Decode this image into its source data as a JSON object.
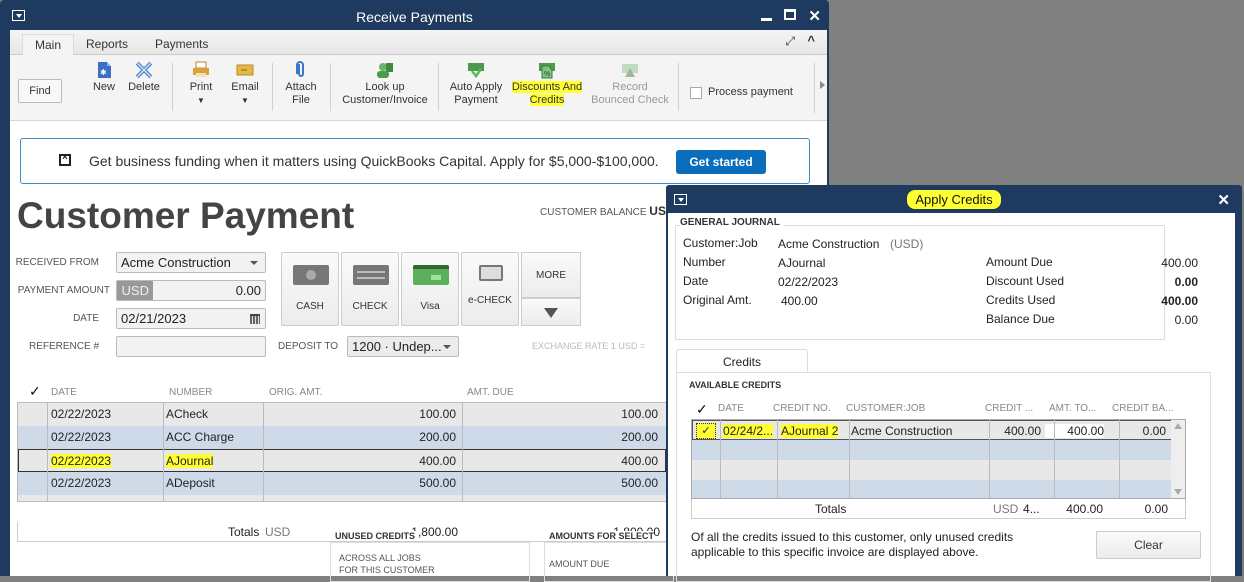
{
  "main_window": {
    "title": "Receive Payments",
    "tabs": [
      "Main",
      "Reports",
      "Payments"
    ],
    "toolbar": {
      "find": "Find",
      "new": "New",
      "delete": "Delete",
      "print": "Print",
      "email": "Email",
      "attach_line1": "Attach",
      "attach_line2": "File",
      "lookup_line1": "Look up",
      "lookup_line2": "Customer/Invoice",
      "auto_apply_line1": "Auto Apply",
      "auto_apply_line2": "Payment",
      "discounts_line1": "Discounts And",
      "discounts_line2": "Credits",
      "bounced_line1": "Record",
      "bounced_line2": "Bounced Check",
      "process_payment": "Process payment"
    },
    "banner": {
      "text": "Get business funding when it matters using QuickBooks Capital. Apply for $5,000-$100,000.",
      "button": "Get started"
    },
    "page_title": "Customer Payment",
    "customer_balance_label": "CUSTOMER BALANCE",
    "customer_balance_currency": "USD",
    "form": {
      "received_from_label": "RECEIVED FROM",
      "received_from_value": "Acme Construction",
      "payment_amount_label": "PAYMENT AMOUNT",
      "payment_currency": "USD",
      "payment_amount_value": "0.00",
      "date_label": "DATE",
      "date_value": "02/21/2023",
      "reference_label": "REFERENCE #",
      "reference_value": "",
      "deposit_to_label": "DEPOSIT TO",
      "deposit_to_value": "1200 · Undep...",
      "exchange_rate_label": "EXCHANGE RATE 1 USD ="
    },
    "payment_methods": [
      "CASH",
      "CHECK",
      "Visa",
      "e-CHECK"
    ],
    "more_label": "MORE",
    "grid": {
      "headers": [
        "✓",
        "DATE",
        "NUMBER",
        "ORIG. AMT.",
        "AMT. DUE"
      ],
      "rows": [
        {
          "date": "02/22/2023",
          "number": "ACheck",
          "orig": "100.00",
          "due": "100.00"
        },
        {
          "date": "02/22/2023",
          "number": "ACC Charge",
          "orig": "200.00",
          "due": "200.00"
        },
        {
          "date": "02/22/2023",
          "number": "AJournal",
          "orig": "400.00",
          "due": "400.00"
        },
        {
          "date": "02/22/2023",
          "number": "ADeposit",
          "orig": "500.00",
          "due": "500.00"
        }
      ],
      "totals_label": "Totals",
      "totals_currency": "USD",
      "total_orig": "1,800.00",
      "total_due": "1,800.00"
    },
    "unused_credits_label": "UNUSED CREDITS",
    "unused_credits_line1": "ACROSS ALL JOBS",
    "unused_credits_line2": "FOR THIS CUSTOMER",
    "amounts_for_selected_label": "AMOUNTS FOR SELECT",
    "amount_due_label": "AMOUNT DUE"
  },
  "apply_credits": {
    "title": "Apply Credits",
    "section_title": "GENERAL JOURNAL",
    "customer_job_label": "Customer:Job",
    "customer_job_value": "Acme Construction",
    "currency": "(USD)",
    "number_label": "Number",
    "number_value": "AJournal",
    "date_label": "Date",
    "date_value": "02/22/2023",
    "original_amt_label": "Original Amt.",
    "original_amt_value": "400.00",
    "amount_due_label": "Amount Due",
    "amount_due_value": "400.00",
    "discount_used_label": "Discount Used",
    "discount_used_value": "0.00",
    "credits_used_label": "Credits Used",
    "credits_used_value": "400.00",
    "balance_due_label": "Balance Due",
    "balance_due_value": "0.00",
    "tab_label": "Credits",
    "available_credits_label": "AVAILABLE CREDITS",
    "headers": [
      "✓",
      "DATE",
      "CREDIT NO.",
      "CUSTOMER:JOB",
      "CREDIT ...",
      "AMT. TO...",
      "CREDIT BA..."
    ],
    "rows": [
      {
        "checked": "✓",
        "date": "02/24/2...",
        "credit_no": "AJournal 2",
        "customer_job": "Acme Construction",
        "credit": "400.00",
        "amt_to_use": "400.00",
        "balance": "0.00"
      }
    ],
    "totals_label": "Totals",
    "totals_currency": "USD",
    "total_credit": "4...",
    "total_amt_to_use": "400.00",
    "total_balance": "0.00",
    "note_line1": "Of all the credits issued to this customer, only unused credits",
    "note_line2": "applicable to this specific invoice are displayed above.",
    "clear_button": "Clear"
  }
}
